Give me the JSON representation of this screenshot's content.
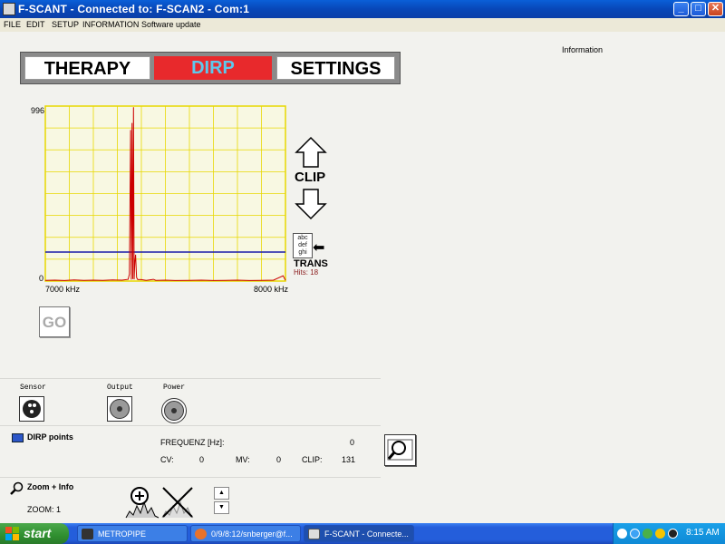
{
  "window": {
    "title": "F-SCANT - Connected to: F-SCAN2 - Com:1",
    "min_label": "_",
    "max_label": "□",
    "close_label": "✕"
  },
  "menu": [
    "FILE",
    "EDIT",
    "SETUP",
    "INFORMATION",
    "Software update"
  ],
  "tabs": {
    "therapy": "THERAPY",
    "dirp": "DIRP",
    "settings": "SETTINGS",
    "active": "DIRP"
  },
  "info_label": "Information",
  "chart_data": {
    "type": "line",
    "title": "",
    "xlabel": "",
    "ylabel": "",
    "x_start_label": "7000 kHz",
    "x_end_label": "8000 kHz",
    "y_max_label": "996",
    "y_min_label": "0",
    "xlim": [
      7000,
      8000
    ],
    "ylim": [
      0,
      996
    ],
    "grid": true,
    "threshold": 165,
    "series": [
      {
        "color": "#cc0000",
        "points": [
          [
            7000,
            4
          ],
          [
            7040,
            5
          ],
          [
            7080,
            3
          ],
          [
            7120,
            6
          ],
          [
            7160,
            4
          ],
          [
            7200,
            5
          ],
          [
            7240,
            4
          ],
          [
            7280,
            6
          ],
          [
            7320,
            5
          ],
          [
            7345,
            10
          ],
          [
            7350,
            40
          ],
          [
            7355,
            860
          ],
          [
            7358,
            8
          ],
          [
            7361,
            900
          ],
          [
            7364,
            12
          ],
          [
            7367,
            990
          ],
          [
            7370,
            10
          ],
          [
            7373,
            110
          ],
          [
            7376,
            150
          ],
          [
            7380,
            20
          ],
          [
            7385,
            8
          ],
          [
            7400,
            8
          ],
          [
            7420,
            4
          ],
          [
            7450,
            10
          ],
          [
            7460,
            4
          ],
          [
            7500,
            5
          ],
          [
            7540,
            3
          ],
          [
            7600,
            4
          ],
          [
            7650,
            5
          ],
          [
            7700,
            3
          ],
          [
            7750,
            4
          ],
          [
            7800,
            5
          ],
          [
            7850,
            3
          ],
          [
            7900,
            4
          ],
          [
            7950,
            5
          ],
          [
            7990,
            30
          ],
          [
            8000,
            4
          ]
        ]
      }
    ]
  },
  "controls": {
    "clip_label": "CLIP",
    "trans_icon_text": "abc def ghi",
    "trans_label": "TRANS",
    "hits_label": "Hits: 18",
    "go_label": "GO"
  },
  "indicators": {
    "sensor": "Sensor",
    "output": "Output",
    "power": "Power"
  },
  "dirp_points": {
    "title": "DIRP points",
    "freq_label": "FREQUENZ [Hz]:",
    "freq_value": "0",
    "cv_label": "CV:",
    "cv_value": "0",
    "mv_label": "MV:",
    "mv_value": "0",
    "clip_label": "CLIP:",
    "clip_value": "131"
  },
  "zoom_info": {
    "title": "Zoom + Info",
    "zoom_label": "ZOOM: 1",
    "up": "▲",
    "down": "▼"
  },
  "taskbar": {
    "start": "start",
    "tasks": [
      "METROPIPE",
      "0/9/8:12/snberger@f...",
      "F-SCANT - Connecte..."
    ],
    "clock": "8:15 AM"
  }
}
